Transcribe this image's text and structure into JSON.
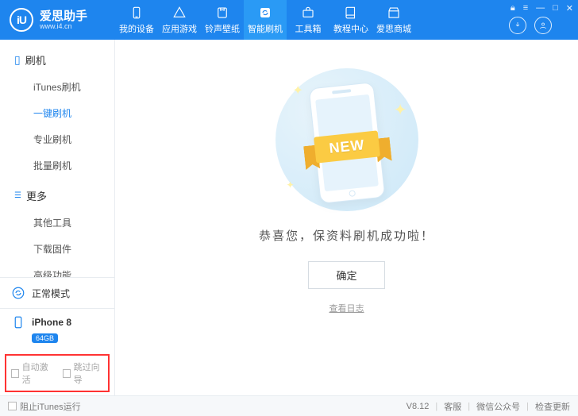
{
  "brand": {
    "logo_text": "iU",
    "name": "爱思助手",
    "url": "www.i4.cn"
  },
  "nav": [
    {
      "id": "device",
      "label": "我的设备"
    },
    {
      "id": "apps",
      "label": "应用游戏"
    },
    {
      "id": "ring",
      "label": "铃声壁纸"
    },
    {
      "id": "flash",
      "label": "智能刷机",
      "active": true
    },
    {
      "id": "toolbox",
      "label": "工具箱"
    },
    {
      "id": "tutorial",
      "label": "教程中心"
    },
    {
      "id": "mall",
      "label": "爱思商城"
    }
  ],
  "sidebar": {
    "sections": [
      {
        "title": "刷机",
        "items": [
          {
            "id": "itunes-flash",
            "label": "iTunes刷机"
          },
          {
            "id": "oneclick-flash",
            "label": "一键刷机",
            "active": true
          },
          {
            "id": "pro-flash",
            "label": "专业刷机"
          },
          {
            "id": "batch-flash",
            "label": "批量刷机"
          }
        ]
      },
      {
        "title": "更多",
        "items": [
          {
            "id": "other-tools",
            "label": "其他工具"
          },
          {
            "id": "download-fw",
            "label": "下载固件"
          },
          {
            "id": "advanced",
            "label": "高级功能"
          }
        ]
      }
    ],
    "mode_card": {
      "label": "正常模式"
    },
    "device_card": {
      "name": "iPhone 8",
      "storage": "64GB"
    },
    "options": {
      "auto_activate": "自动激活",
      "skip_guide": "跳过向导"
    }
  },
  "main": {
    "ribbon_text": "NEW",
    "message": "恭喜您，保资料刷机成功啦！",
    "confirm_label": "确定",
    "view_log_label": "查看日志"
  },
  "footer": {
    "block_itunes": "阻止iTunes运行",
    "version": "V8.12",
    "support": "客服",
    "wechat": "微信公众号",
    "check_update": "检查更新"
  }
}
